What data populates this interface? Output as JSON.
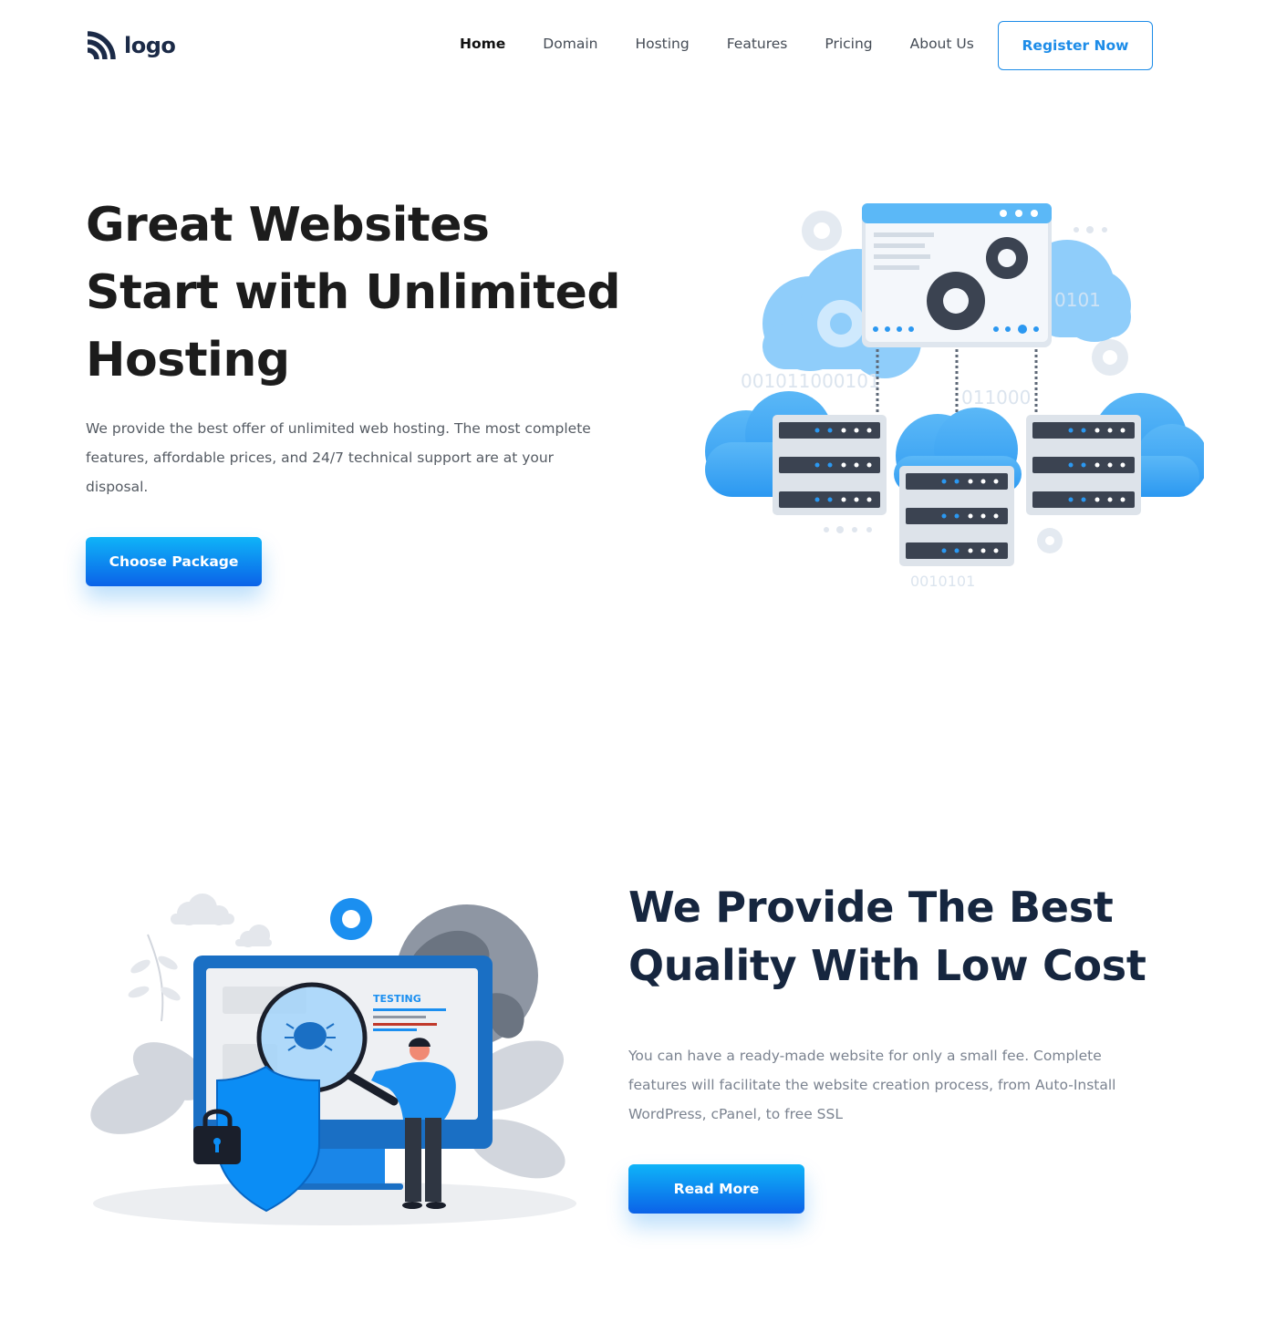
{
  "brand": {
    "logo_text": "logo",
    "logo_icon": "signal-arcs-icon"
  },
  "nav": {
    "items": [
      {
        "label": "Home",
        "active": true
      },
      {
        "label": "Domain"
      },
      {
        "label": "Hosting"
      },
      {
        "label": "Features"
      },
      {
        "label": "Pricing"
      },
      {
        "label": "About Us"
      }
    ],
    "register_label": "Register Now"
  },
  "hero": {
    "title": "Great Websites Start with Unlimited Hosting",
    "description": "We provide the best offer of unlimited web hosting. The most complete features, affordable prices, and 24/7 technical support are at your disposal.",
    "cta_label": "Choose Package",
    "illustration": {
      "icon": "cloud-servers-illustration",
      "binary_texts": [
        "0101",
        "001011000101",
        "011000",
        "0010101"
      ]
    }
  },
  "quality": {
    "title": "We Provide The Best Quality With Low Cost",
    "description": "You can have a ready-made website for only a small fee. Complete features will facilitate the website creation process, from Auto-Install WordPress, cPanel, to free SSL",
    "cta_label": "Read More",
    "illustration": {
      "icon": "security-testing-illustration",
      "screen_label": "TESTING"
    }
  },
  "colors": {
    "accent": "#1d8ce8",
    "gradient_top": "#0fb4f8",
    "gradient_bottom": "#0b62e8",
    "heading_dark": "#16263f",
    "cloud_blue": "#3aa6f5",
    "server_dark": "#3b4351"
  }
}
